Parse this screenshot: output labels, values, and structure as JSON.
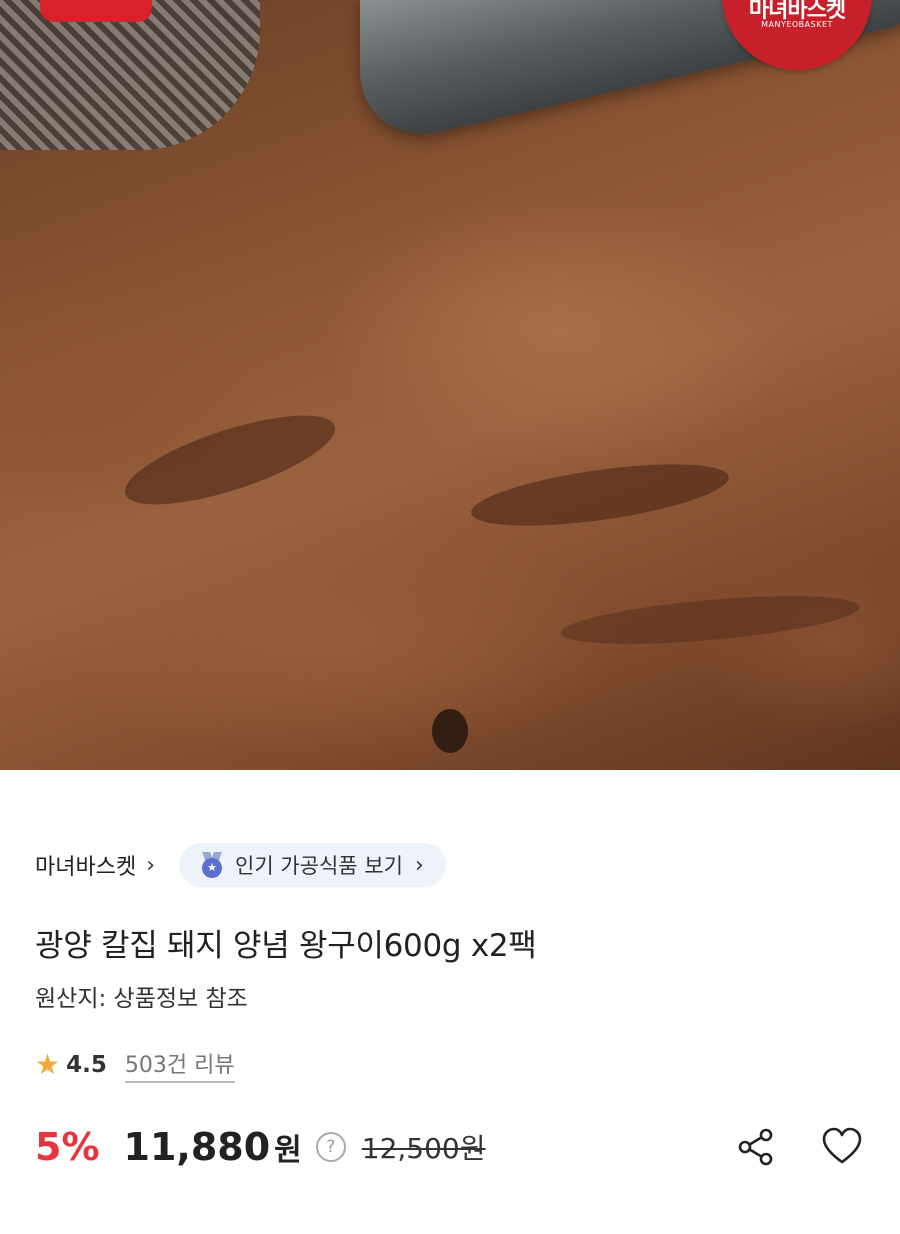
{
  "hero": {
    "logo_text": "마녀바스켓",
    "logo_subtext": "MANYEOBASKET"
  },
  "brand": {
    "name": "마녀바스켓",
    "chevron": "›"
  },
  "tag": {
    "label": "인기 가공식품 보기",
    "icon": "medal-icon",
    "chevron": "›"
  },
  "product": {
    "title": "광양 칼집 돼지 양념 왕구이600g x2팩",
    "origin": "원산지: 상품정보 참조"
  },
  "rating": {
    "score": "4.5",
    "reviews": "503건 리뷰",
    "star_color": "#f3a83a"
  },
  "price": {
    "discount": "5%",
    "sale_price": "11,880",
    "currency": "원",
    "help_icon": "?",
    "original_price": "12,500원",
    "discount_color": "#e8343f"
  },
  "actions": {
    "share_icon": "share-icon",
    "like_icon": "heart-icon"
  }
}
